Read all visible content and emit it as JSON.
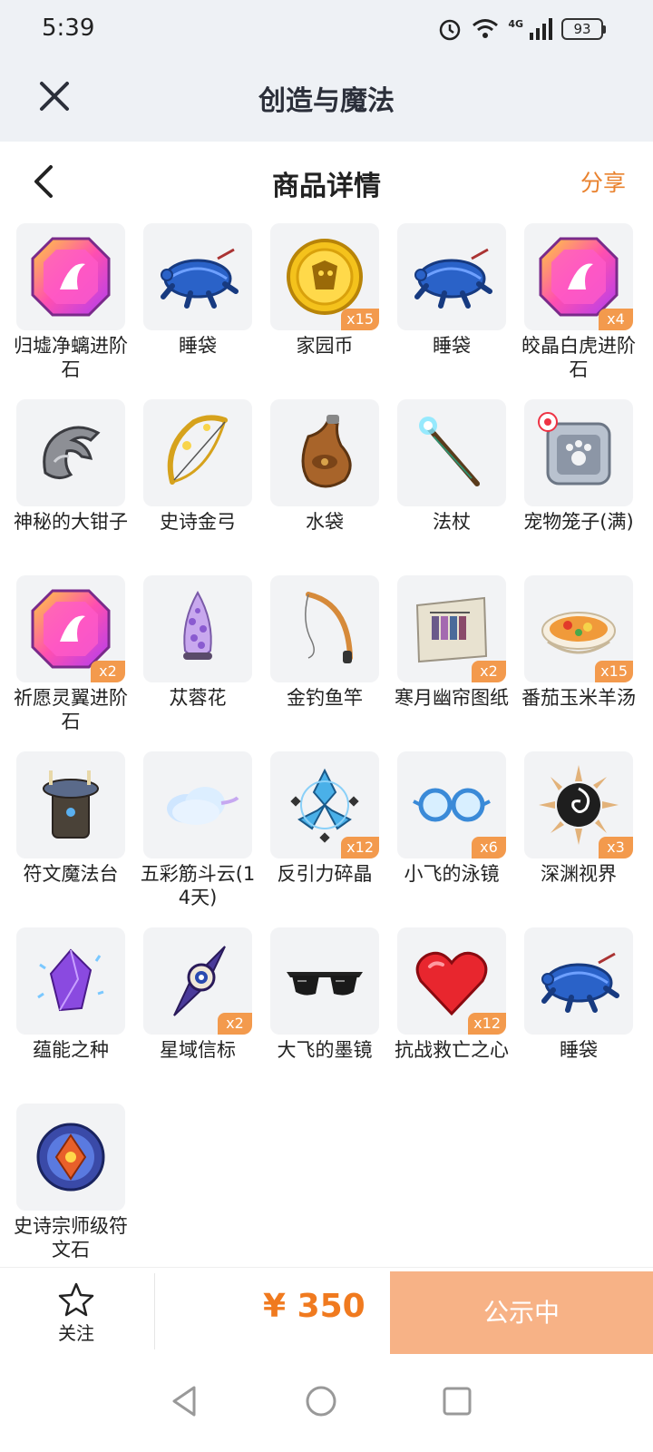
{
  "status": {
    "time": "5:39",
    "network": "4G",
    "battery": "93"
  },
  "app": {
    "title": "创造与魔法"
  },
  "page": {
    "title": "商品详情",
    "share": "分享"
  },
  "items": [
    {
      "label": "归墟净螭进阶石",
      "badge": "",
      "icon": "pink-gem-icon"
    },
    {
      "label": "睡袋",
      "badge": "",
      "icon": "sleeping-bag-icon"
    },
    {
      "label": "家园币",
      "badge": "x15",
      "icon": "gold-coin-icon"
    },
    {
      "label": "睡袋",
      "badge": "",
      "icon": "sleeping-bag-icon"
    },
    {
      "label": "皎晶白虎进阶石",
      "badge": "x4",
      "icon": "pink-gem-icon"
    },
    {
      "label": "神秘的大钳子",
      "badge": "",
      "icon": "claw-icon"
    },
    {
      "label": "史诗金弓",
      "badge": "",
      "icon": "golden-bow-icon"
    },
    {
      "label": "水袋",
      "badge": "",
      "icon": "water-bag-icon"
    },
    {
      "label": "法杖",
      "badge": "",
      "icon": "staff-icon"
    },
    {
      "label": "宠物笼子(满)",
      "badge": "",
      "icon": "pet-cage-icon"
    },
    {
      "label": "祈愿灵翼进阶石",
      "badge": "x2",
      "icon": "pink-gem-icon"
    },
    {
      "label": "苁蓉花",
      "badge": "",
      "icon": "cistanche-flower-icon"
    },
    {
      "label": "金钓鱼竿",
      "badge": "",
      "icon": "fishing-rod-icon"
    },
    {
      "label": "寒月幽帘图纸",
      "badge": "x2",
      "icon": "blueprint-icon"
    },
    {
      "label": "番茄玉米羊汤",
      "badge": "x15",
      "icon": "soup-bowl-icon"
    },
    {
      "label": "符文魔法台",
      "badge": "",
      "icon": "rune-altar-icon"
    },
    {
      "label": "五彩筋斗云(14天)",
      "badge": "",
      "icon": "cloud-icon"
    },
    {
      "label": "反引力碎晶",
      "badge": "x12",
      "icon": "anti-gravity-crystal-icon"
    },
    {
      "label": "小飞的泳镜",
      "badge": "x6",
      "icon": "goggles-icon"
    },
    {
      "label": "深渊视界",
      "badge": "x3",
      "icon": "abyss-eye-icon"
    },
    {
      "label": "蕴能之种",
      "badge": "",
      "icon": "purple-crystal-icon"
    },
    {
      "label": "星域信标",
      "badge": "x2",
      "icon": "star-beacon-icon"
    },
    {
      "label": "大飞的墨镜",
      "badge": "",
      "icon": "sunglasses-icon"
    },
    {
      "label": "抗战救亡之心",
      "badge": "x12",
      "icon": "red-heart-icon"
    },
    {
      "label": "睡袋",
      "badge": "",
      "icon": "sleeping-bag-icon"
    },
    {
      "label": "史诗宗师级符文石",
      "badge": "",
      "icon": "rune-stone-icon"
    }
  ],
  "bottom": {
    "follow": "关注",
    "price": "¥ 350",
    "button": "公示中"
  },
  "colors": {
    "accent": "#f07a1f",
    "button_bg": "#f7b286",
    "badge_bg": "#f39a4d",
    "header_bg": "#eef1f5"
  }
}
